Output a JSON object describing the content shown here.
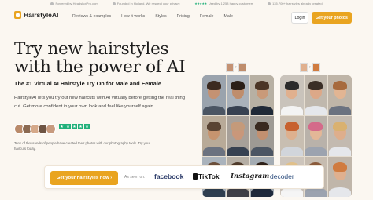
{
  "topbar": {
    "items": [
      {
        "icon": "camera-icon",
        "text": "Powered by HeadshotPro.com"
      },
      {
        "icon": "flag-icon",
        "text": "Founded in Holland. We respect your privacy."
      },
      {
        "icon": "star-rating-icon",
        "stars": "★★★★★",
        "text": "Used by 1,258 happy customers"
      },
      {
        "icon": "photo-icon",
        "text": "135,700+ hairstyles already created"
      }
    ]
  },
  "nav": {
    "logo": "HairstyleAI",
    "links": [
      "Reviews & examples",
      "How it works",
      "Styles",
      "Pricing",
      "Female",
      "Male"
    ],
    "login": "Login",
    "cta": "Get your photos"
  },
  "hero": {
    "title_line1": "Try new hairstyles",
    "title_line2": "with the power of AI",
    "subtitle": "The #1 Virtual AI Hairstyle Try On for Male and Female",
    "description": "HairstyleAI lets you try out new haircuts with AI virtually before getting the real thing cut. Get more confident in your own look and feel like yourself again.",
    "rating_stars": [
      "★",
      "★",
      "★",
      "★",
      "★"
    ],
    "social_proof": "Tens of thousands of people have created their photos with our photography tools. Try your haircuts today."
  },
  "cta_bar": {
    "button": "Get your hairstyles now ›",
    "as_seen_on": "As seen on:",
    "brands": [
      "facebook",
      "TikTok",
      "Instagram",
      "decoder"
    ]
  },
  "colors": {
    "accent": "#e9a420",
    "background": "#fbf7f1",
    "star_green": "#21b07a",
    "brand_navy": "#2a3a68"
  },
  "avatars": [
    "#b98a6a",
    "#8b6a52",
    "#d5a98a",
    "#6e5443",
    "#c79a7e"
  ],
  "panels": {
    "male": [
      {
        "skin": "#c49273",
        "hair": "#3b2a20",
        "shirt": "#4b5563",
        "bg": "#9aa3ad"
      },
      {
        "skin": "#bf8d6c",
        "hair": "#2a1f18",
        "shirt": "#374151",
        "bg": "#a9b1ba"
      },
      {
        "skin": "#c99a79",
        "hair": "#4a3526",
        "shirt": "#1f2937",
        "bg": "#b7b0a3"
      },
      {
        "skin": "#c6946f",
        "hair": "#5a4433",
        "shirt": "#6b7280",
        "bg": "#b8aa98"
      },
      {
        "skin": "#c9977a",
        "hair": "#c49a7a",
        "shirt": "#374151",
        "bg": "#a7a099"
      },
      {
        "skin": "#c29070",
        "hair": "#3a2a20",
        "shirt": "#4b5563",
        "bg": "#9e9a94"
      },
      {
        "skin": "#c79573",
        "hair": "#6b4f3a",
        "shirt": "#2f3e4f",
        "bg": "#aab3bc"
      },
      {
        "skin": "#c08e6d",
        "hair": "#4f3b2b",
        "shirt": "#3f3f46",
        "bg": "#b5aea4"
      },
      {
        "skin": "#c59270",
        "hair": "#2e2119",
        "shirt": "#1e293b",
        "bg": "#a4acb3"
      }
    ],
    "female": [
      {
        "skin": "#e0b08e",
        "hair": "#2b2b2b",
        "shirt": "#f3f3f3",
        "bg": "#c9c3bb"
      },
      {
        "skin": "#dca888",
        "hair": "#3a2e26",
        "shirt": "#e5e7eb",
        "bg": "#c0b8ad"
      },
      {
        "skin": "#e2b593",
        "hair": "#a76a3d",
        "shirt": "#6b7280",
        "bg": "#bfb5a8"
      },
      {
        "skin": "#ddb08e",
        "hair": "#c7612f",
        "shirt": "#d1d5db",
        "bg": "#c8beb1"
      },
      {
        "skin": "#e3b797",
        "hair": "#d46a8a",
        "shirt": "#9ca3af",
        "bg": "#b9b2aa"
      },
      {
        "skin": "#deae8c",
        "hair": "#d9b170",
        "shirt": "#e5e7eb",
        "bg": "#c3bab0"
      },
      {
        "skin": "#e1b391",
        "hair": "#e0c08a",
        "shirt": "#f5f5f5",
        "bg": "#cdc5bc"
      },
      {
        "skin": "#dcac8a",
        "hair": "#8a5a3b",
        "shirt": "#9ca3af",
        "bg": "#c6bcb0"
      },
      {
        "skin": "#dfb08f",
        "hair": "#d07b3f",
        "shirt": "#e5e7eb",
        "bg": "#c0b6aa"
      }
    ]
  },
  "thumbs": {
    "male_before": "#c49273",
    "male_after": "#bf8d6c",
    "female_before": "#e0b08e",
    "female_after": "#d07b3f",
    "arrow": "›"
  }
}
